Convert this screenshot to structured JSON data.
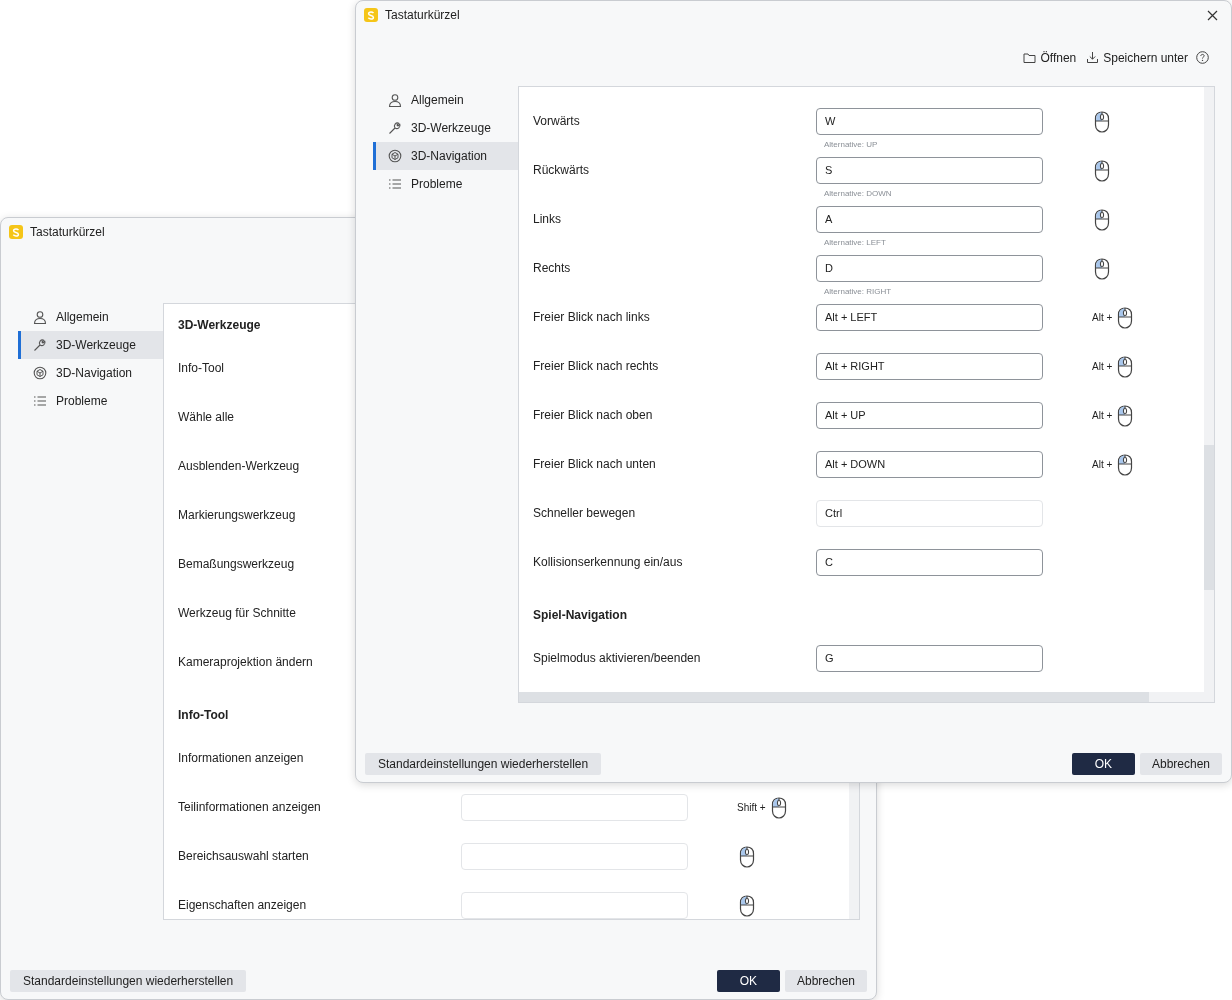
{
  "windows": [
    {
      "title": "Tastaturkürzel",
      "sidebar": {
        "items": [
          {
            "label": "Allgemein",
            "selected": false
          },
          {
            "label": "3D-Werkzeuge",
            "selected": true
          },
          {
            "label": "3D-Navigation",
            "selected": false
          },
          {
            "label": "Probleme",
            "selected": false
          }
        ]
      },
      "rows": [
        {
          "kind": "heading",
          "label": "3D-Werkzeuge"
        },
        {
          "kind": "shortcut",
          "label": "Info-Tool"
        },
        {
          "kind": "shortcut",
          "label": "Wähle alle"
        },
        {
          "kind": "shortcut",
          "label": "Ausblenden-Werkzeug"
        },
        {
          "kind": "shortcut",
          "label": "Markierungswerkzeug"
        },
        {
          "kind": "shortcut",
          "label": "Bemaßungswerkzeug"
        },
        {
          "kind": "shortcut",
          "label": "Werkzeug für Schnitte"
        },
        {
          "kind": "shortcut",
          "label": "Kameraprojektion ändern"
        },
        {
          "kind": "heading",
          "label": "Info-Tool"
        },
        {
          "kind": "shortcut",
          "label": "Informationen anzeigen"
        },
        {
          "kind": "shortcut",
          "label": "Teilinformationen anzeigen",
          "field": true,
          "disabled": true,
          "mouse": true,
          "modifier": "Shift +"
        },
        {
          "kind": "shortcut",
          "label": "Bereichsauswahl starten",
          "field": true,
          "disabled": true,
          "mouse": true
        },
        {
          "kind": "shortcut",
          "label": "Eigenschaften anzeigen",
          "field": true,
          "disabled": true,
          "mouse": true
        }
      ],
      "footer": {
        "reset": "Standardeinstellungen wiederherstellen",
        "buttons": [
          {
            "label": "OK",
            "kind": "primary"
          },
          {
            "label": "Abbrechen",
            "kind": "secondary"
          }
        ]
      }
    },
    {
      "title": "Tastaturkürzel",
      "close": true,
      "toolbar": [
        {
          "label": "Öffnen",
          "kind": "open"
        },
        {
          "label": "Speichern unter",
          "kind": "save"
        }
      ],
      "help": true,
      "sidebar": {
        "items": [
          {
            "label": "Allgemein",
            "selected": false
          },
          {
            "label": "3D-Werkzeuge",
            "selected": false
          },
          {
            "label": "3D-Navigation",
            "selected": true
          },
          {
            "label": "Probleme",
            "selected": false
          }
        ]
      },
      "rows": [
        {
          "kind": "shortcut",
          "label": "Vorwärts",
          "field": true,
          "value": "W",
          "disabled": false,
          "hint": "Alternative: UP",
          "mouse": true
        },
        {
          "kind": "shortcut",
          "label": "Rückwärts",
          "field": true,
          "value": "S",
          "disabled": false,
          "hint": "Alternative: DOWN",
          "mouse": true
        },
        {
          "kind": "shortcut",
          "label": "Links",
          "field": true,
          "value": "A",
          "disabled": false,
          "hint": "Alternative: LEFT",
          "mouse": true
        },
        {
          "kind": "shortcut",
          "label": "Rechts",
          "field": true,
          "value": "D",
          "disabled": false,
          "hint": "Alternative: RIGHT",
          "mouse": true
        },
        {
          "kind": "shortcut",
          "label": "Freier Blick nach links",
          "field": true,
          "value": "Alt + LEFT",
          "disabled": false,
          "mouse": true,
          "modifier": "Alt +"
        },
        {
          "kind": "shortcut",
          "label": "Freier Blick nach rechts",
          "field": true,
          "value": "Alt + RIGHT",
          "disabled": false,
          "mouse": true,
          "modifier": "Alt +"
        },
        {
          "kind": "shortcut",
          "label": "Freier Blick nach oben",
          "field": true,
          "value": "Alt + UP",
          "disabled": false,
          "mouse": true,
          "modifier": "Alt +"
        },
        {
          "kind": "shortcut",
          "label": "Freier Blick nach unten",
          "field": true,
          "value": "Alt + DOWN",
          "disabled": false,
          "mouse": true,
          "modifier": "Alt +"
        },
        {
          "kind": "shortcut",
          "label": "Schneller bewegen",
          "field": true,
          "value": "Ctrl",
          "disabled": true
        },
        {
          "kind": "shortcut",
          "label": "Kollisionserkennung ein/aus",
          "field": true,
          "value": "C",
          "disabled": false
        },
        {
          "kind": "heading",
          "label": "Spiel-Navigation"
        },
        {
          "kind": "shortcut",
          "label": "Spielmodus aktivieren/beenden",
          "field": true,
          "value": "G",
          "disabled": false
        }
      ],
      "footer": {
        "reset": "Standardeinstellungen wiederherstellen",
        "buttons": [
          {
            "label": "OK",
            "kind": "primary"
          },
          {
            "label": "Abbrechen",
            "kind": "secondary"
          }
        ]
      }
    }
  ]
}
